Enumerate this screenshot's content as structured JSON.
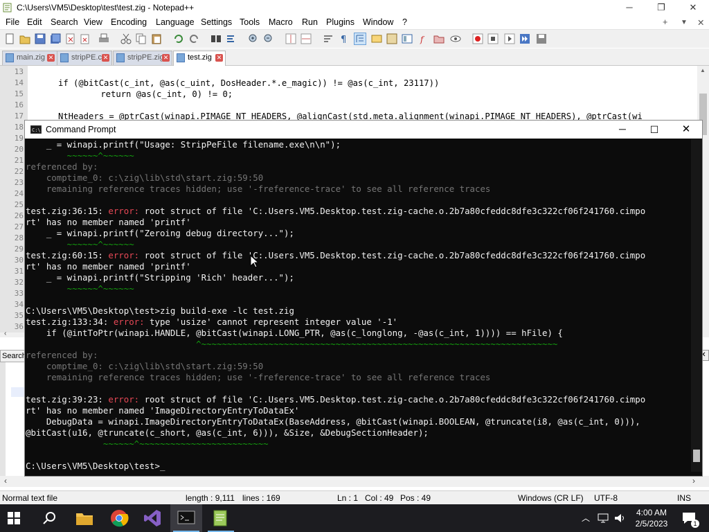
{
  "npp": {
    "title": "C:\\Users\\VM5\\Desktop\\test\\test.zig - Notepad++",
    "menu": [
      "File",
      "Edit",
      "Search",
      "View",
      "Encoding",
      "Language",
      "Settings",
      "Tools",
      "Macro",
      "Run",
      "Plugins",
      "Window",
      "?"
    ],
    "menu_right": [
      "+",
      "▼",
      "✕"
    ],
    "tabs": [
      {
        "label": "main.zig",
        "active": false
      },
      {
        "label": "stripPE.c",
        "active": false
      },
      {
        "label": "stripPE.zig",
        "active": false
      },
      {
        "label": "test.zig",
        "active": true
      }
    ],
    "line_numbers": [
      "13",
      "14",
      "15",
      "16",
      "17",
      "18",
      "19",
      "20",
      "21",
      "22",
      "23",
      "24",
      "25",
      "26",
      "27",
      "28",
      "29",
      "30",
      "31",
      "32",
      "33",
      "34",
      "35",
      "36"
    ],
    "code_lines": [
      "if (@bitCast(c_int, @as(c_uint, DosHeader.*.e_magic)) != @as(c_int, 23117))",
      "    return @as(c_int, 0) != 0;",
      "NtHeaders = @ptrCast(winapi.PIMAGE_NT_HEADERS, @alignCast(std.meta.alignment(winapi.PIMAGE_NT_HEADERS), @ptrCast(wi"
    ],
    "search_panel_label": "Search",
    "status": {
      "type": "Normal text file",
      "length": "length : 9,111",
      "lines": "lines : 169",
      "ln": "Ln : 1",
      "col": "Col : 49",
      "pos": "Pos : 49",
      "eol": "Windows (CR LF)",
      "encoding": "UTF-8",
      "mode": "INS"
    }
  },
  "cmd": {
    "title": "Command Prompt",
    "lines": [
      {
        "parts": [
          {
            "t": "    _ = winapi.printf(\"Usage: StripPeFile filename.exe\\n\\n\");",
            "c": "wht"
          }
        ]
      },
      {
        "parts": [
          {
            "t": "        ~~~~~~^~~~~~~",
            "c": "grn"
          }
        ]
      },
      {
        "parts": [
          {
            "t": "referenced by:",
            "c": "gray"
          }
        ]
      },
      {
        "parts": [
          {
            "t": "    comptime_0: c:\\zig\\lib\\std\\start.zig:59:50",
            "c": "gray"
          }
        ]
      },
      {
        "parts": [
          {
            "t": "    remaining reference traces hidden; use '-freference-trace' to see all reference traces",
            "c": "gray"
          }
        ]
      },
      {
        "parts": [
          {
            "t": "",
            "c": "wht"
          }
        ]
      },
      {
        "parts": [
          {
            "t": "test.zig:36:15: ",
            "c": "wht"
          },
          {
            "t": "error: ",
            "c": "red"
          },
          {
            "t": "root struct of file 'C:.Users.VM5.Desktop.test.zig-cache.o.2b7a80cfeddc8dfe3c322cf06f241760.cimpo",
            "c": "wht"
          }
        ]
      },
      {
        "parts": [
          {
            "t": "rt' has no member named 'printf'",
            "c": "wht"
          }
        ]
      },
      {
        "parts": [
          {
            "t": "    _ = winapi.printf(\"Zeroing debug directory...\");",
            "c": "wht"
          }
        ]
      },
      {
        "parts": [
          {
            "t": "        ~~~~~~^~~~~~~",
            "c": "grn"
          }
        ]
      },
      {
        "parts": [
          {
            "t": "test.zig:60:15: ",
            "c": "wht"
          },
          {
            "t": "error: ",
            "c": "red"
          },
          {
            "t": "root struct of file 'C:.Users.VM5.Desktop.test.zig-cache.o.2b7a80cfeddc8dfe3c322cf06f241760.cimpo",
            "c": "wht"
          }
        ]
      },
      {
        "parts": [
          {
            "t": "rt' has no member named 'printf'",
            "c": "wht"
          }
        ]
      },
      {
        "parts": [
          {
            "t": "    _ = winapi.printf(\"Stripping 'Rich' header...\");",
            "c": "wht"
          }
        ]
      },
      {
        "parts": [
          {
            "t": "        ~~~~~~^~~~~~~",
            "c": "grn"
          }
        ]
      },
      {
        "parts": [
          {
            "t": "",
            "c": "wht"
          }
        ]
      },
      {
        "parts": [
          {
            "t": "C:\\Users\\VM5\\Desktop\\test>zig build-exe -lc test.zig",
            "c": "wht"
          }
        ]
      },
      {
        "parts": [
          {
            "t": "test.zig:133:34: ",
            "c": "wht"
          },
          {
            "t": "error: ",
            "c": "red"
          },
          {
            "t": "type 'usize' cannot represent integer value '-1'",
            "c": "wht"
          }
        ]
      },
      {
        "parts": [
          {
            "t": "    if (@intToPtr(winapi.HANDLE, @bitCast(winapi.LONG_PTR, @as(c_longlong, -@as(c_int, 1)))) == hFile) {",
            "c": "wht"
          }
        ]
      },
      {
        "parts": [
          {
            "t": "                                 ^~~~~~~~~~~~~~~~~~~~~~~~~~~~~~~~~~~~~~~~~~~~~~~~~~~~~~~~~~~~~~~~~~~~~~",
            "c": "grn"
          }
        ]
      },
      {
        "parts": [
          {
            "t": "referenced by:",
            "c": "gray"
          }
        ]
      },
      {
        "parts": [
          {
            "t": "    comptime_0: c:\\zig\\lib\\std\\start.zig:59:50",
            "c": "gray"
          }
        ]
      },
      {
        "parts": [
          {
            "t": "    remaining reference traces hidden; use '-freference-trace' to see all reference traces",
            "c": "gray"
          }
        ]
      },
      {
        "parts": [
          {
            "t": "",
            "c": "wht"
          }
        ]
      },
      {
        "parts": [
          {
            "t": "test.zig:39:23: ",
            "c": "wht"
          },
          {
            "t": "error: ",
            "c": "red"
          },
          {
            "t": "root struct of file 'C:.Users.VM5.Desktop.test.zig-cache.o.2b7a80cfeddc8dfe3c322cf06f241760.cimpo",
            "c": "wht"
          }
        ]
      },
      {
        "parts": [
          {
            "t": "rt' has no member named 'ImageDirectoryEntryToDataEx'",
            "c": "wht"
          }
        ]
      },
      {
        "parts": [
          {
            "t": "    DebugData = winapi.ImageDirectoryEntryToDataEx(BaseAddress, @bitCast(winapi.BOOLEAN, @truncate(i8, @as(c_int, 0))),",
            "c": "wht"
          }
        ]
      },
      {
        "parts": [
          {
            "t": "@bitCast(u16, @truncate(c_short, @as(c_int, 6))), &Size, &DebugSectionHeader);",
            "c": "wht"
          }
        ]
      },
      {
        "parts": [
          {
            "t": "               ~~~~~~^~~~~~~~~~~~~~~~~~~~~~~~~~",
            "c": "grn"
          }
        ]
      },
      {
        "parts": [
          {
            "t": "",
            "c": "wht"
          }
        ]
      },
      {
        "parts": [
          {
            "t": "C:\\Users\\VM5\\Desktop\\test>",
            "c": "wht"
          }
        ]
      }
    ]
  },
  "taskbar": {
    "time": "4:00 AM",
    "date": "2/5/2023"
  },
  "colors": {
    "taskbar_bg": "#1c1c20",
    "cmd_bg": "#0c0c0c",
    "error_red": "#e74856",
    "caret_green": "#13a10e"
  }
}
